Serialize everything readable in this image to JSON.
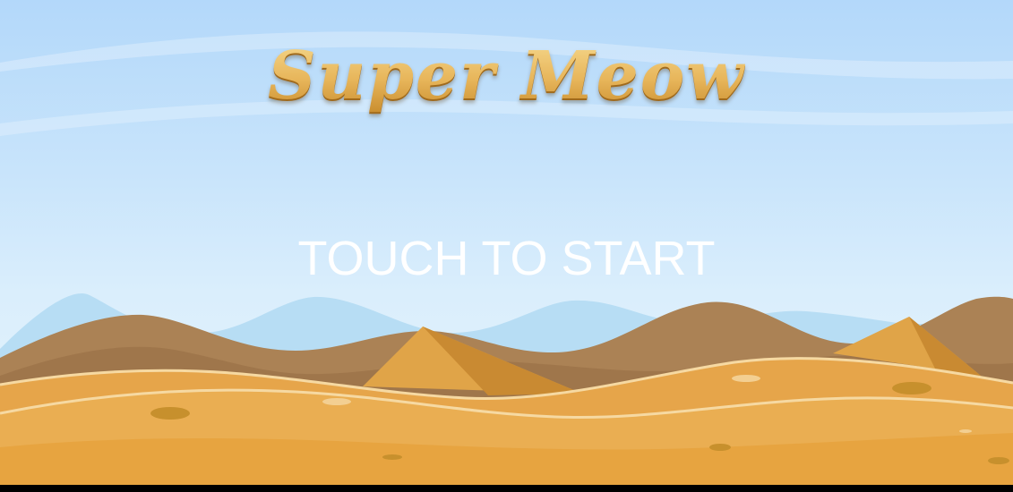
{
  "game": {
    "title": "Super Meow",
    "prompt": "TOUCH TO START"
  },
  "colors": {
    "sky_top": "#b3d8fa",
    "sky_bottom": "#e6f4fd",
    "far_hills": "#b7ddf4",
    "brown_dunes": "#ab8255",
    "pyramid_light": "#e0a448",
    "pyramid_dark": "#c98a32",
    "sand": "#e9a846",
    "title_gold": "#e3ad4f",
    "prompt_text": "#ffffff"
  }
}
